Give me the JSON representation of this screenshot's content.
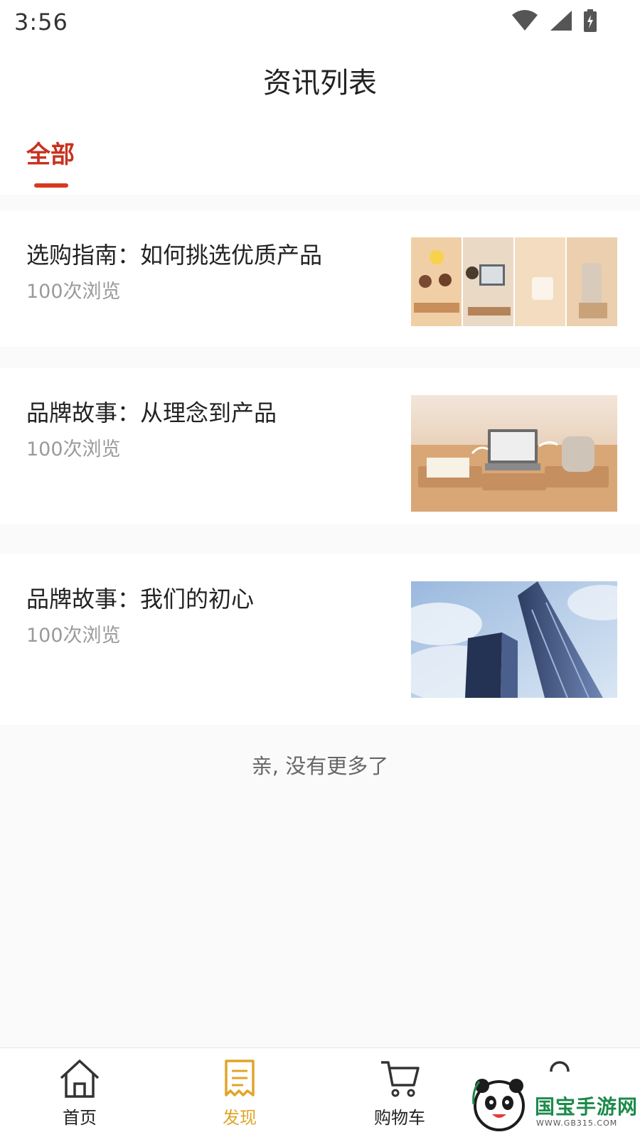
{
  "status_bar": {
    "time": "3:56"
  },
  "header": {
    "title": "资讯列表"
  },
  "tabs": [
    {
      "label": "全部",
      "active": true
    }
  ],
  "articles": [
    {
      "title": "选购指南：如何挑选优质产品",
      "views": "100次浏览"
    },
    {
      "title": "品牌故事：从理念到产品",
      "views": "100次浏览"
    },
    {
      "title": "品牌故事：我们的初心",
      "views": "100次浏览"
    }
  ],
  "list_end_text": "亲, 没有更多了",
  "bottom_nav": {
    "items": [
      {
        "label": "首页",
        "icon": "home-icon",
        "active": false
      },
      {
        "label": "发现",
        "icon": "discover-icon",
        "active": true
      },
      {
        "label": "购物车",
        "icon": "cart-icon",
        "active": false
      },
      {
        "label": "",
        "icon": "user-icon",
        "active": false
      }
    ]
  },
  "watermark": {
    "text": "国宝手游网",
    "url": "WWW.GB315.COM"
  },
  "colors": {
    "accent": "#d8391f",
    "nav_active": "#e0a52a",
    "muted_text": "#9a9a9a"
  }
}
